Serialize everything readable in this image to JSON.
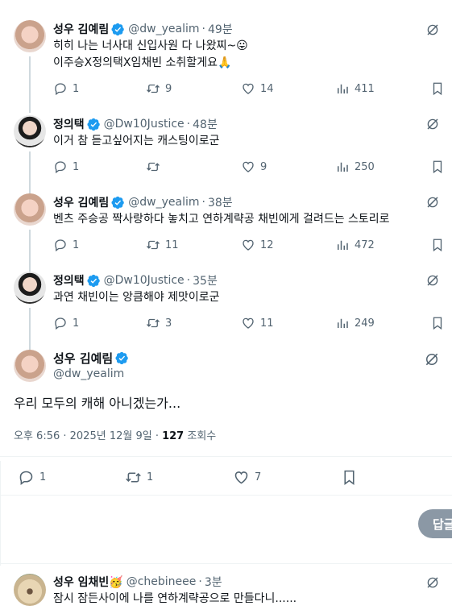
{
  "replies": [
    {
      "name": "성우 김예림",
      "handle": "@dw_yealim",
      "time": "49분",
      "lines": [
        "히히 나는 너사대 신입사원 다 나왔찌~😛",
        "이주승X정의택X임채빈 소취할게요🙏"
      ],
      "reply": "1",
      "retweet": "9",
      "like": "14",
      "views": "411"
    },
    {
      "name": "정의택",
      "handle": "@Dw10Justice",
      "time": "48분",
      "lines": [
        "이거 참 듣고싶어지는 캐스팅이로군"
      ],
      "reply": "1",
      "retweet": "",
      "like": "9",
      "views": "250"
    },
    {
      "name": "성우 김예림",
      "handle": "@dw_yealim",
      "time": "38분",
      "lines": [
        "벤츠 주승공 짝사랑하다 놓치고 연하계략공 채빈에게 걸려드는 스토리로"
      ],
      "reply": "1",
      "retweet": "11",
      "like": "12",
      "views": "472"
    },
    {
      "name": "정의택",
      "handle": "@Dw10Justice",
      "time": "35분",
      "lines": [
        "과연 채빈이는 앙큼해야 제맛이로군"
      ],
      "reply": "1",
      "retweet": "3",
      "like": "11",
      "views": "249"
    }
  ],
  "main": {
    "name": "성우 김예림",
    "handle": "@dw_yealim",
    "text": "우리 모두의 캐해 아니겠는가...",
    "meta_prefix": "오후 6:56 · 2025년 12월 9일 · ",
    "views": "127",
    "views_label": " 조회수",
    "reply": "1",
    "retweet": "1",
    "like": "7"
  },
  "reply_button": "답글",
  "bottom": {
    "name": "성우 임채빈🥳",
    "handle": "@chebineee",
    "time": "3분",
    "text": "잠시 잠든사이에 나를 연하계략공으로 만들다니......"
  },
  "colors": {
    "verified": "#1d9bf0",
    "muted": "#536471",
    "text": "#0f1419"
  }
}
